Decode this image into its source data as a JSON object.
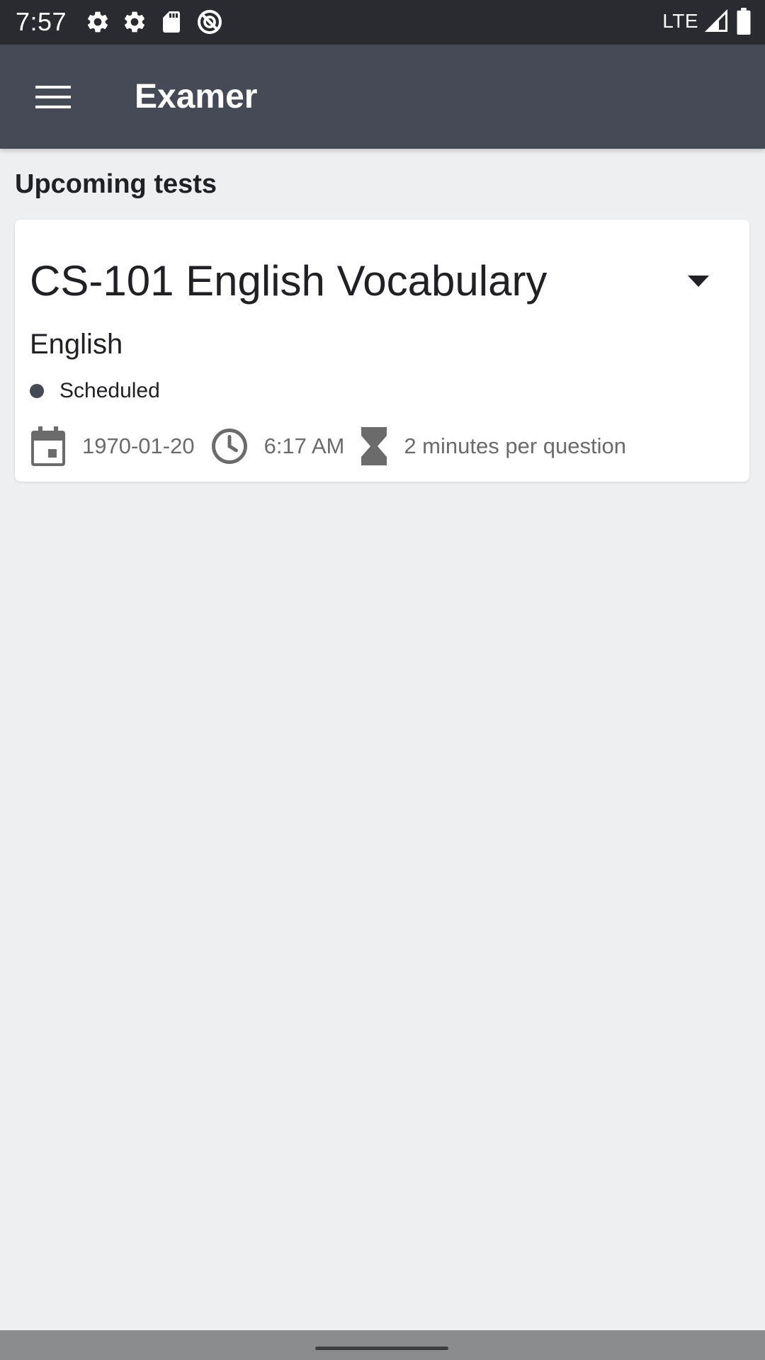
{
  "status_bar": {
    "time": "7:57",
    "network": "LTE",
    "left_icons": [
      "settings-icon",
      "settings-icon",
      "sd-card-icon",
      "do-not-disturb-icon"
    ],
    "right_icons": [
      "signal-icon",
      "battery-icon"
    ]
  },
  "app_bar": {
    "title": "Examer",
    "menu_icon": "hamburger-menu-icon",
    "color": "#464a56"
  },
  "main": {
    "section_heading": "Upcoming tests",
    "tests": [
      {
        "title": "CS-101 English Vocabulary",
        "subject": "English",
        "status": "Scheduled",
        "status_color": "#464a56",
        "date": "1970-01-20",
        "time": "6:17 AM",
        "duration": "2 minutes per question",
        "icons": [
          "calendar-icon",
          "clock-icon",
          "hourglass-icon",
          "dropdown-arrow-icon"
        ]
      }
    ]
  },
  "colors": {
    "status_bar": "#292b31",
    "background": "#eeeff1",
    "card": "#ffffff",
    "secondary_text": "#6b6b6b"
  }
}
